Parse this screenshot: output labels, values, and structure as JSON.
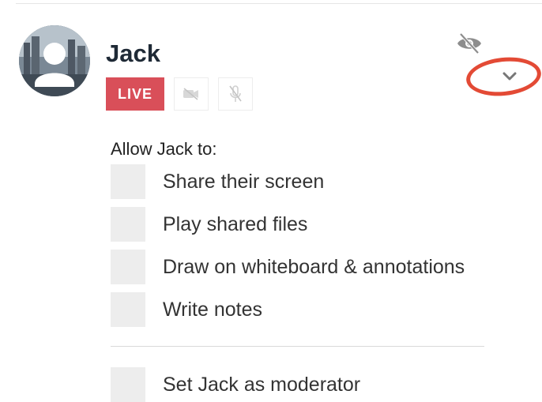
{
  "participant": {
    "name": "Jack",
    "live_label": "LIVE"
  },
  "permissions": {
    "title": "Allow Jack to:",
    "items": [
      {
        "label": "Share their screen",
        "checked": false
      },
      {
        "label": "Play shared files",
        "checked": false
      },
      {
        "label": "Draw on whiteboard & annotations",
        "checked": false
      },
      {
        "label": "Write notes",
        "checked": false
      }
    ],
    "moderator": {
      "label": "Set Jack as moderator",
      "checked": false
    }
  },
  "icons": {
    "avatar": "user-silhouette-icon",
    "camera": "camera-off-icon",
    "mic": "mic-off-icon",
    "visibility": "eye-off-icon",
    "expand": "chevron-down-icon"
  },
  "colors": {
    "live": "#d94f59",
    "highlight": "#e34a35",
    "checkbox": "#ededed"
  }
}
